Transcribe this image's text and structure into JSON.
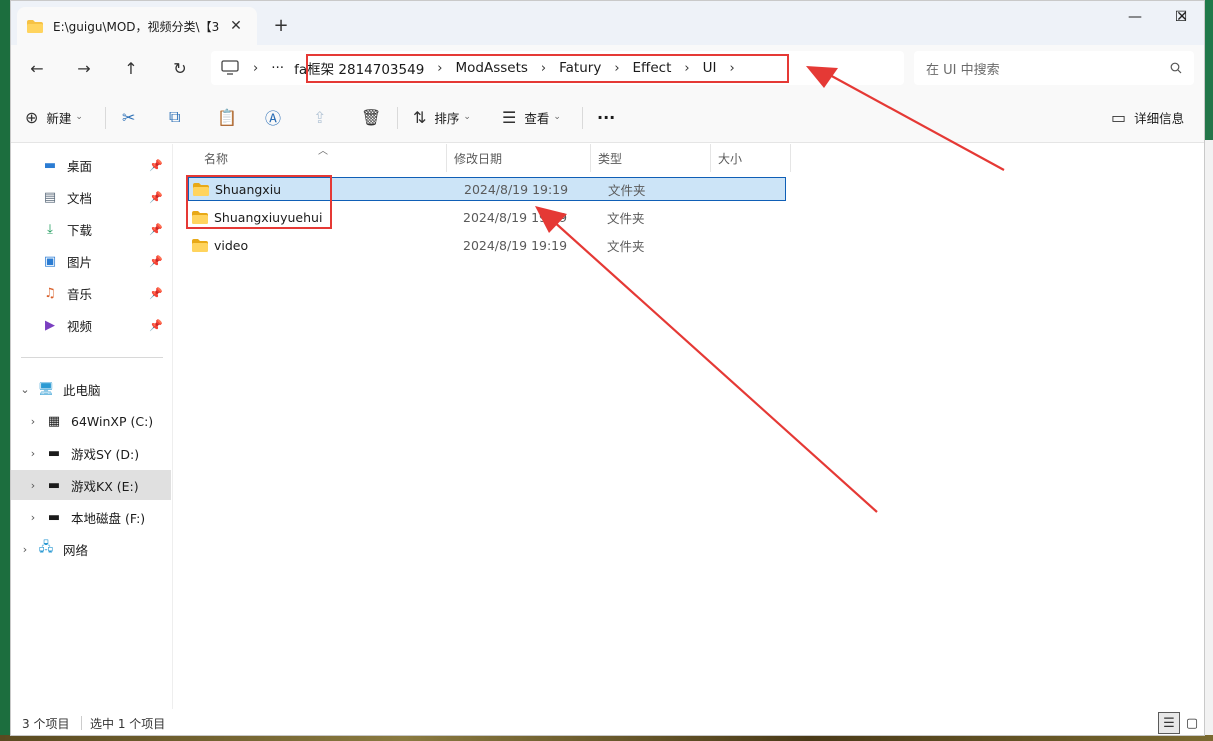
{
  "window": {
    "tab_title": "E:\\guigu\\MOD，视频分类\\【3",
    "tab_close": "✕",
    "new_tab": "+",
    "minimize": "—",
    "maximize": "☐",
    "close": "✕"
  },
  "nav": {
    "back": "←",
    "forward": "→",
    "up": "↑",
    "refresh": "↻",
    "more": "···",
    "separator": "›"
  },
  "breadcrumbs": [
    "fa框架 2814703549",
    "ModAssets",
    "Fatury",
    "Effect",
    "UI"
  ],
  "search": {
    "placeholder": "在 UI 中搜索"
  },
  "toolbar": {
    "new_label": "新建",
    "sort_label": "排序",
    "view_label": "查看",
    "more_label": "···",
    "details_label": "详细信息"
  },
  "sidebar": {
    "quick_access": [
      {
        "label": "桌面",
        "icon": "desktop-icon"
      },
      {
        "label": "文档",
        "icon": "documents-icon"
      },
      {
        "label": "下载",
        "icon": "download-icon"
      },
      {
        "label": "图片",
        "icon": "pictures-icon"
      },
      {
        "label": "音乐",
        "icon": "music-icon"
      },
      {
        "label": "视频",
        "icon": "videos-icon"
      }
    ],
    "this_pc": "此电脑",
    "drives": [
      {
        "label": "64WinXP  (C:)"
      },
      {
        "label": "游戏SY (D:)"
      },
      {
        "label": "游戏KX (E:)"
      },
      {
        "label": "本地磁盘 (F:)"
      }
    ],
    "network": "网络"
  },
  "columns": {
    "name": "名称",
    "modified": "修改日期",
    "type": "类型",
    "size": "大小"
  },
  "files": [
    {
      "name": "Shuangxiu",
      "modified": "2024/8/19 19:19",
      "type": "文件夹",
      "selected": true
    },
    {
      "name": "Shuangxiuyuehui",
      "modified": "2024/8/19 19:19",
      "type": "文件夹",
      "selected": false
    },
    {
      "name": "video",
      "modified": "2024/8/19 19:19",
      "type": "文件夹",
      "selected": false
    }
  ],
  "status": {
    "count": "3 个项目",
    "selected": "选中 1 个项目"
  },
  "colors": {
    "annotation_red": "#e53935",
    "selection_bg": "#cce4f7",
    "folder_yellow": "#f6c244"
  }
}
